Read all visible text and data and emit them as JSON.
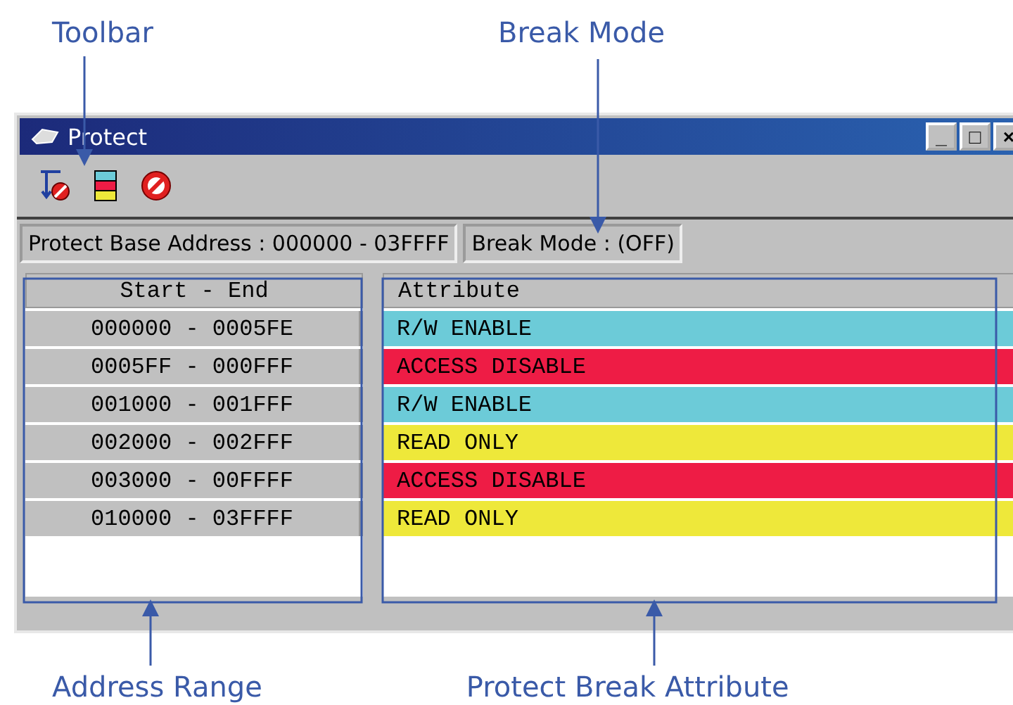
{
  "annotations": {
    "top": [
      "Toolbar",
      "Break Mode"
    ],
    "bottom": [
      "Address Range",
      "Protect Break Attribute"
    ]
  },
  "window": {
    "title": "Protect",
    "controls": [
      "_",
      "□",
      "×"
    ]
  },
  "toolbar": [
    {
      "kind": "protect-break"
    },
    {
      "kind": "attribute"
    },
    {
      "kind": "disable"
    }
  ],
  "status": [
    "Protect Base Address : 000000 - 03FFFF",
    "Break Mode : (OFF)"
  ],
  "table": {
    "columns": [
      "Start - End",
      "Attribute"
    ],
    "rows": [
      {
        "range": "000000 - 0005FE",
        "attribute": "R/W ENABLE",
        "color": "#6ccbd8"
      },
      {
        "range": "0005FF - 000FFF",
        "attribute": "ACCESS DISABLE",
        "color": "#ee1c45"
      },
      {
        "range": "001000 - 001FFF",
        "attribute": "R/W ENABLE",
        "color": "#6ccbd8"
      },
      {
        "range": "002000 - 002FFF",
        "attribute": "READ ONLY",
        "color": "#eee83a"
      },
      {
        "range": "003000 - 00FFFF",
        "attribute": "ACCESS DISABLE",
        "color": "#ee1c45"
      },
      {
        "range": "010000 - 03FFFF",
        "attribute": "READ ONLY",
        "color": "#eee83a"
      }
    ]
  }
}
